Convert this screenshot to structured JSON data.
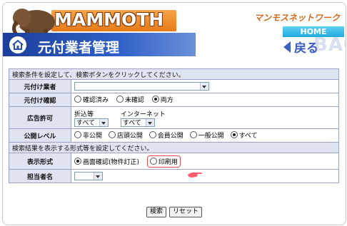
{
  "header": {
    "logo": "MAMMOTH",
    "brand": "マンモスネットワーク",
    "home_label": "HOME",
    "page_title": "元付業者管理",
    "back_label": "戻る",
    "back_watermark": "BACK"
  },
  "form": {
    "section_search": "検索条件を設定して、検索ボタンをクリックしてください。",
    "motozuke_label": "元付け業者",
    "motozuke_value": "",
    "confirm_label": "元付け確認",
    "confirm_options": [
      "確認済み",
      "未確認",
      "両方"
    ],
    "confirm_selected": "両方",
    "ad_label": "広告許可",
    "ad_sub1_caption": "折込等",
    "ad_sub1_value": "すべて",
    "ad_sub2_caption": "インターネット",
    "ad_sub2_value": "すべて",
    "public_label": "公開レベル",
    "public_options": [
      "非公開",
      "店頭公開",
      "会員公開",
      "一般公開",
      "すべて"
    ],
    "public_selected": "すべて",
    "section_display": "検索結果を表示する形式等を設定してください。",
    "display_label": "表示形式",
    "display_options": [
      "画面確認(物件訂正)",
      "印刷用"
    ],
    "display_selected": "画面確認(物件訂正)",
    "staff_label": "担当者名",
    "staff_value": ""
  },
  "buttons": {
    "search": "検索",
    "reset": "リセット"
  },
  "colors": {
    "accent_orange": "#e77b17",
    "title_blue": "#1c3f9a",
    "highlight_red": "#e05050"
  }
}
